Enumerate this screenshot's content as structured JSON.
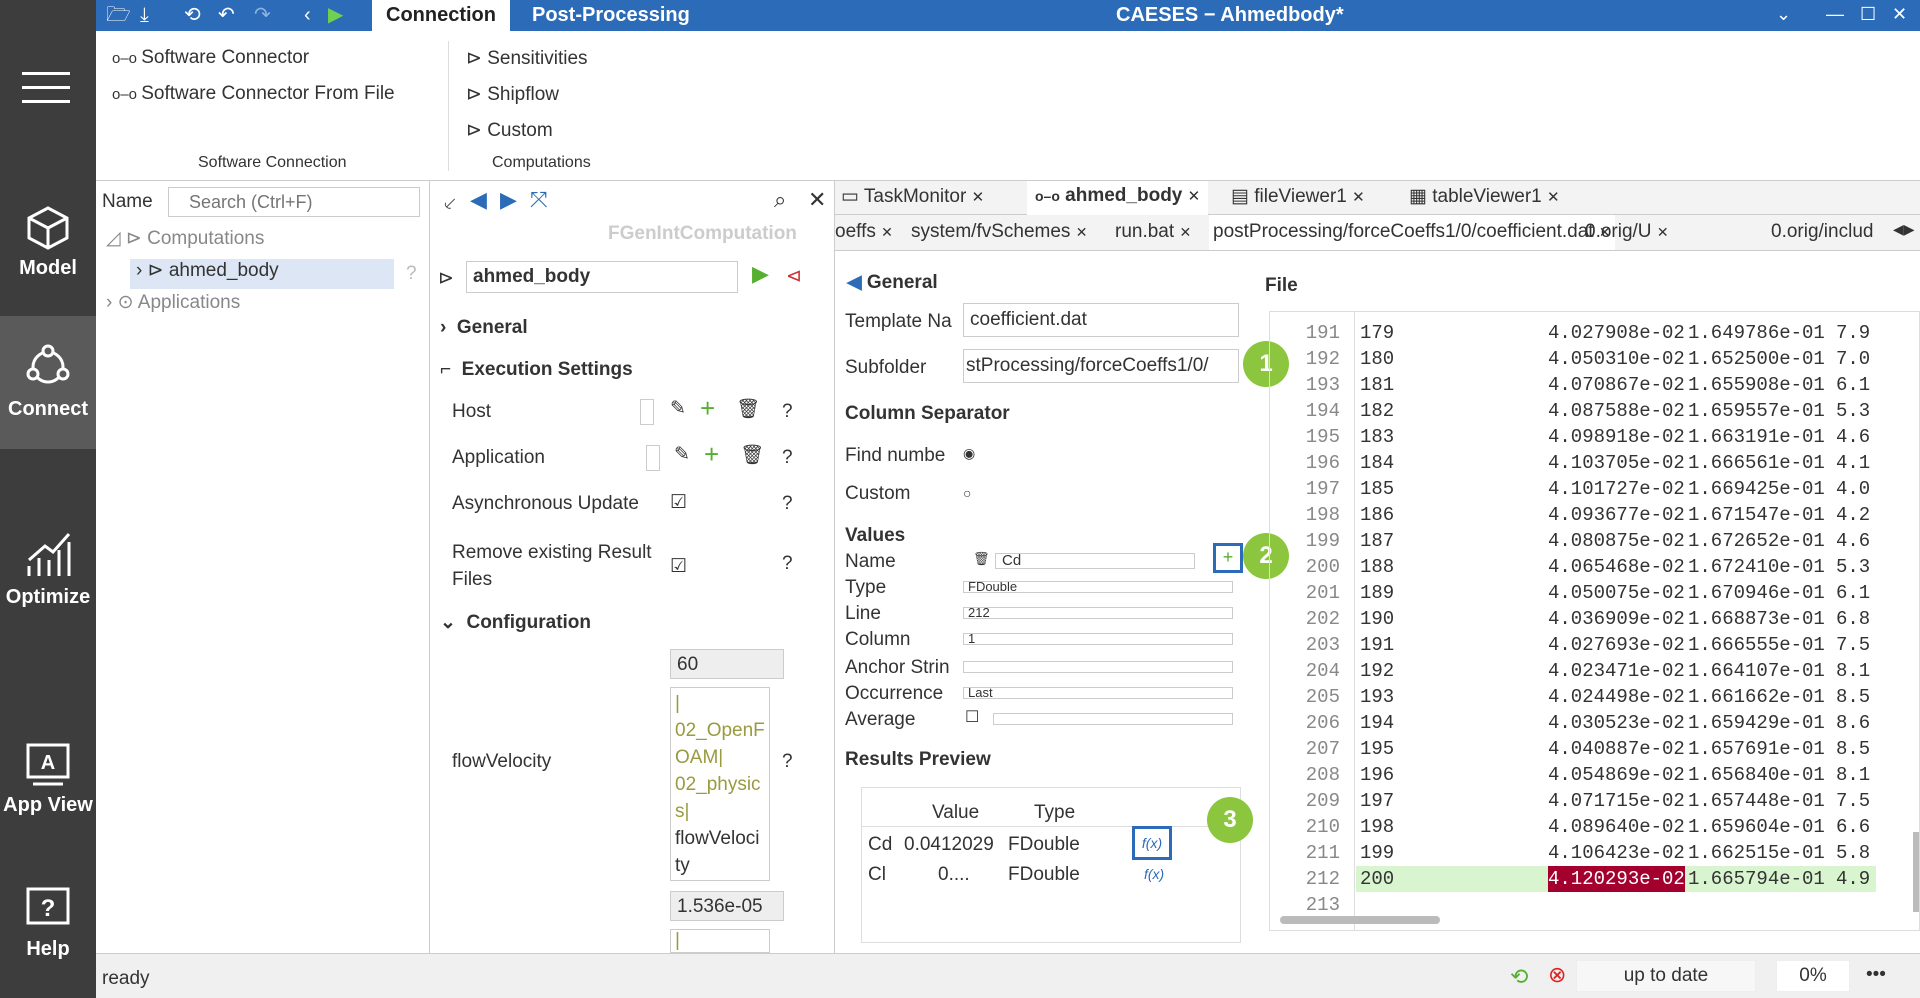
{
  "titlebar": {
    "tab_connection": "Connection",
    "tab_post": "Post-Processing",
    "window_title": "CAESES − Ahmedbody*"
  },
  "leftbar": {
    "model": "Model",
    "connect": "Connect",
    "optimize": "Optimize",
    "app_view": "App View",
    "help": "Help"
  },
  "ribbon": {
    "software_connector": "Software Connector",
    "software_connector_file": "Software Connector From File",
    "group_software": "Software Connection",
    "sensitivities": "Sensitivities",
    "shipflow": "Shipflow",
    "custom": "Custom",
    "group_computations": "Computations"
  },
  "tree": {
    "name_label": "Name",
    "search_placeholder": "Search (Ctrl+F)",
    "computations": "Computations",
    "ahmed_body": "ahmed_body",
    "applications": "Applications"
  },
  "props": {
    "type_label": "FGenIntComputation",
    "name_value": "ahmed_body",
    "general": "General",
    "execution_settings": "Execution Settings",
    "host": "Host",
    "application": "Application",
    "async_update": "Asynchronous Update",
    "remove_results": "Remove existing Result Files",
    "configuration": "Configuration",
    "flow_velocity": "flowVelocity",
    "val_60": "60",
    "path_lines": [
      "|",
      "02_OpenF",
      "OAM|",
      "02_physic",
      "s|",
      "flowVeloci",
      "ty"
    ],
    "val_1536": "1.536e-05",
    "val_pipe": "|"
  },
  "doc_tabs": {
    "taskmonitor": "TaskMonitor",
    "ahmed_body": "ahmed_body",
    "fileviewer": "fileViewer1",
    "tableviewer": "tableViewer1"
  },
  "file_tabs": [
    "oeffs",
    "system/fvSchemes",
    "run.bat",
    "postProcessing/forceCoeffs1/0/coefficient.dat",
    "0.orig/U",
    "0.orig/includ"
  ],
  "general_panel": {
    "general": "General",
    "template_label": "Template Na",
    "template_value": "coefficient.dat",
    "subfolder_label": "Subfolder",
    "subfolder_value": "stProcessing/forceCoeffs1/0/",
    "column_separator": "Column Separator",
    "find_number": "Find numbe",
    "custom": "Custom",
    "values": "Values",
    "name": "Name",
    "name_value": "Cd",
    "type": "Type",
    "type_value": "FDouble",
    "line": "Line",
    "line_value": "212",
    "column": "Column",
    "column_value": "1",
    "anchor": "Anchor Strin",
    "occurrence": "Occurrence",
    "occurrence_value": "Last",
    "average": "Average",
    "results_preview": "Results Preview",
    "col_value": "Value",
    "col_type": "Type",
    "rows": [
      {
        "name": "Cd",
        "value": "0.0412029",
        "type": "FDouble",
        "fx": "f(x)"
      },
      {
        "name": "Cl",
        "value": "0....",
        "type": "FDouble",
        "fx": "f(x)"
      }
    ]
  },
  "badges": {
    "b1": "1",
    "b2": "2",
    "b3": "3"
  },
  "file": {
    "title": "File",
    "rows": [
      {
        "ln": "191",
        "a": "179",
        "b": "4.027908e-02",
        "c": "1.649786e-01",
        "d": "7.9"
      },
      {
        "ln": "192",
        "a": "180",
        "b": "4.050310e-02",
        "c": "1.652500e-01",
        "d": "7.0"
      },
      {
        "ln": "193",
        "a": "181",
        "b": "4.070867e-02",
        "c": "1.655908e-01",
        "d": "6.1"
      },
      {
        "ln": "194",
        "a": "182",
        "b": "4.087588e-02",
        "c": "1.659557e-01",
        "d": "5.3"
      },
      {
        "ln": "195",
        "a": "183",
        "b": "4.098918e-02",
        "c": "1.663191e-01",
        "d": "4.6"
      },
      {
        "ln": "196",
        "a": "184",
        "b": "4.103705e-02",
        "c": "1.666561e-01",
        "d": "4.1"
      },
      {
        "ln": "197",
        "a": "185",
        "b": "4.101727e-02",
        "c": "1.669425e-01",
        "d": "4.0"
      },
      {
        "ln": "198",
        "a": "186",
        "b": "4.093677e-02",
        "c": "1.671547e-01",
        "d": "4.2"
      },
      {
        "ln": "199",
        "a": "187",
        "b": "4.080875e-02",
        "c": "1.672652e-01",
        "d": "4.6"
      },
      {
        "ln": "200",
        "a": "188",
        "b": "4.065468e-02",
        "c": "1.672410e-01",
        "d": "5.3"
      },
      {
        "ln": "201",
        "a": "189",
        "b": "4.050075e-02",
        "c": "1.670946e-01",
        "d": "6.1"
      },
      {
        "ln": "202",
        "a": "190",
        "b": "4.036909e-02",
        "c": "1.668873e-01",
        "d": "6.8"
      },
      {
        "ln": "203",
        "a": "191",
        "b": "4.027693e-02",
        "c": "1.666555e-01",
        "d": "7.5"
      },
      {
        "ln": "204",
        "a": "192",
        "b": "4.023471e-02",
        "c": "1.664107e-01",
        "d": "8.1"
      },
      {
        "ln": "205",
        "a": "193",
        "b": "4.024498e-02",
        "c": "1.661662e-01",
        "d": "8.5"
      },
      {
        "ln": "206",
        "a": "194",
        "b": "4.030523e-02",
        "c": "1.659429e-01",
        "d": "8.6"
      },
      {
        "ln": "207",
        "a": "195",
        "b": "4.040887e-02",
        "c": "1.657691e-01",
        "d": "8.5"
      },
      {
        "ln": "208",
        "a": "196",
        "b": "4.054869e-02",
        "c": "1.656840e-01",
        "d": "8.1"
      },
      {
        "ln": "209",
        "a": "197",
        "b": "4.071715e-02",
        "c": "1.657448e-01",
        "d": "7.5"
      },
      {
        "ln": "210",
        "a": "198",
        "b": "4.089640e-02",
        "c": "1.659604e-01",
        "d": "6.6"
      },
      {
        "ln": "211",
        "a": "199",
        "b": "4.106423e-02",
        "c": "1.662515e-01",
        "d": "5.8"
      },
      {
        "ln": "212",
        "a": "200",
        "b": "4.120293e-02",
        "c": "1.665794e-01",
        "d": "4.9"
      },
      {
        "ln": "213",
        "a": "",
        "b": "",
        "c": "",
        "d": ""
      }
    ]
  },
  "status": {
    "ready": "ready",
    "up_to_date": "up to date",
    "percent": "0%",
    "more": "•••"
  },
  "colors": {
    "accent": "#2b6bb8",
    "sidebar": "#3d3d3d",
    "green": "#8cc63f",
    "highlight": "#a3002e"
  }
}
